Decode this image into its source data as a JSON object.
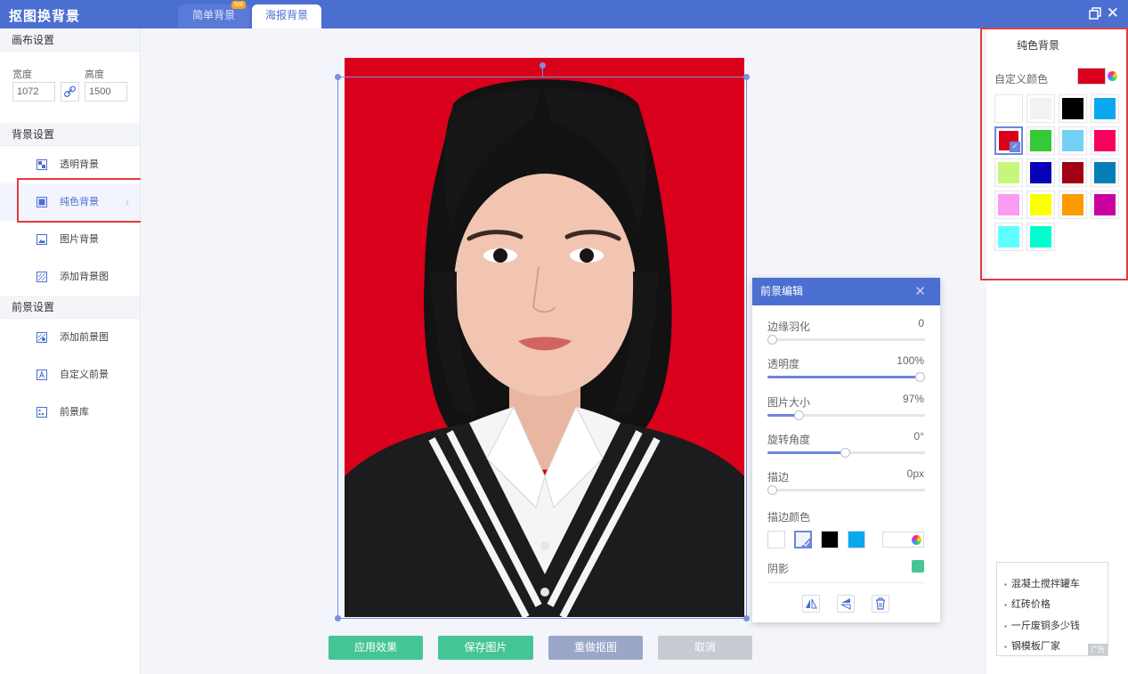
{
  "app": {
    "title": "抠图换背景"
  },
  "tabs": [
    {
      "label": "简单背景",
      "badge": "hot"
    },
    {
      "label": "海报背景"
    }
  ],
  "left": {
    "canvas_section": "画布设置",
    "width_label": "宽度",
    "height_label": "高度",
    "width_value": "1072",
    "height_value": "1500",
    "bg_section": "背景设置",
    "bg_items": [
      "透明背景",
      "纯色背景",
      "图片背景",
      "添加背景图"
    ],
    "fg_section": "前景设置",
    "fg_items": [
      "添加前景图",
      "自定义前景",
      "前景库"
    ]
  },
  "buttons": {
    "apply": "应用效果",
    "save": "保存图片",
    "redo": "重做抠图",
    "cancel": "取消"
  },
  "fg_panel": {
    "title": "前景编辑",
    "feather_label": "边缘羽化",
    "feather_value": "0",
    "feather_level": 0,
    "opacity_label": "透明度",
    "opacity_value": "100%",
    "opacity_level": 1.0,
    "size_label": "图片大小",
    "size_value": "97%",
    "size_level": 0.2,
    "rotate_label": "旋转角度",
    "rotate_value": "0°",
    "rotate_level": 0.49,
    "stroke_label": "描边",
    "stroke_value": "0px",
    "stroke_level": 0,
    "stroke_color_label": "描边颜色",
    "stroke_colors": [
      "#ffffff",
      "#f2f4f8",
      "#000000",
      "#0ba8f0"
    ],
    "shadow_label": "阴影",
    "shadow_color": "#45c595"
  },
  "right": {
    "title": "纯色背景",
    "custom_label": "自定义颜色",
    "current_color": "#d9001b",
    "swatches": [
      "#ffffff",
      "#f2f2f2",
      "#000000",
      "#0ba8f0",
      "#d9001b",
      "#34c936",
      "#74d1f5",
      "#f7005e",
      "#c7f77a",
      "#0600b8",
      "#a30014",
      "#047fb7",
      "#fb9bf1",
      "#fbff00",
      "#fd9a00",
      "#cb009e",
      "#5effff",
      "#00ffd0"
    ],
    "selected_swatch": 4
  },
  "ad": {
    "items": [
      "混凝土搅拌罐车",
      "红砖价格",
      "一斤废铜多少钱",
      "钢模板厂家"
    ],
    "mark": "广告"
  }
}
